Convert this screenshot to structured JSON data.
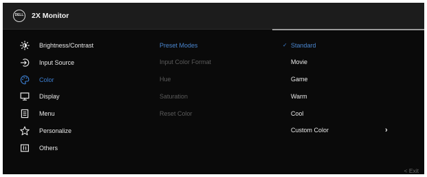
{
  "header": {
    "logo_text": "DELL",
    "title": "2X Monitor"
  },
  "main_menu": [
    {
      "label": "Brightness/Contrast",
      "icon": "brightness-icon"
    },
    {
      "label": "Input Source",
      "icon": "input-source-icon"
    },
    {
      "label": "Color",
      "icon": "palette-icon",
      "active": true
    },
    {
      "label": "Display",
      "icon": "display-icon"
    },
    {
      "label": "Menu",
      "icon": "menu-icon"
    },
    {
      "label": "Personalize",
      "icon": "star-icon"
    },
    {
      "label": "Others",
      "icon": "info-icon"
    }
  ],
  "color_submenu": [
    {
      "label": "Preset Modes",
      "active": true
    },
    {
      "label": "Input Color Format"
    },
    {
      "label": "Hue"
    },
    {
      "label": "Saturation"
    },
    {
      "label": "Reset Color"
    }
  ],
  "preset_options": [
    {
      "label": "Standard",
      "selected": true
    },
    {
      "label": "Movie"
    },
    {
      "label": "Game"
    },
    {
      "label": "Warm"
    },
    {
      "label": "Cool"
    },
    {
      "label": "Custom Color",
      "has_submenu": true
    }
  ],
  "check_glyph": "✓",
  "submenu_arrow_glyph": "›",
  "footer": {
    "exit_label": "<  Exit"
  },
  "colors": {
    "accent": "#3d7fd1",
    "text": "#eaeaea",
    "disabled_text": "#5b5b5b",
    "background": "#0a0a0a",
    "header": "#1c1c1c"
  }
}
